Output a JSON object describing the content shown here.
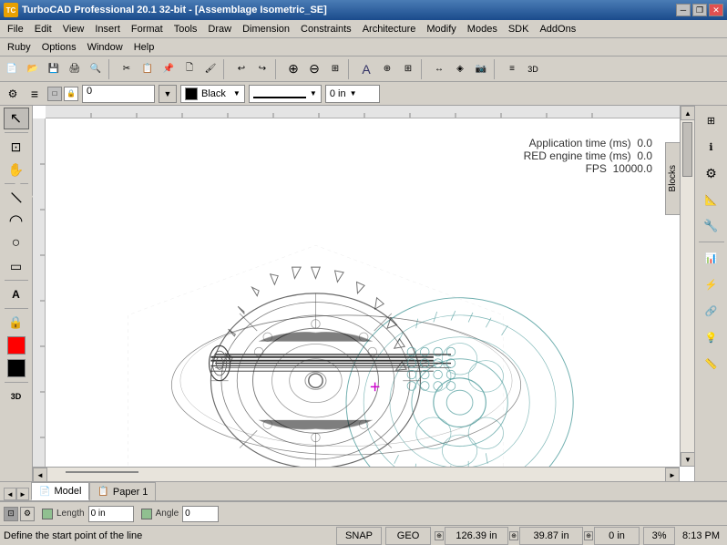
{
  "titlebar": {
    "icon_label": "TC",
    "title": "TurboCAD Professional 20.1 32-bit - [Assemblage Isometric_SE]",
    "minimize_label": "─",
    "maximize_label": "□",
    "close_label": "✕",
    "restore_label": "❐"
  },
  "menubar": {
    "items": [
      "File",
      "Edit",
      "View",
      "Insert",
      "Format",
      "Tools",
      "Draw",
      "Dimension",
      "Constraints",
      "Architecture",
      "Modify",
      "Modes",
      "SDK",
      "AddOns"
    ]
  },
  "menubar2": {
    "items": [
      "Ruby",
      "Options",
      "Window",
      "Help"
    ]
  },
  "toolbar": {
    "buttons": [
      {
        "name": "new",
        "label": "📄"
      },
      {
        "name": "open",
        "label": "📂"
      },
      {
        "name": "save",
        "label": "💾"
      },
      {
        "name": "print",
        "label": "🖨"
      },
      {
        "name": "preview",
        "label": "🔍"
      },
      {
        "name": "cut",
        "label": "✂"
      },
      {
        "name": "copy",
        "label": "📋"
      },
      {
        "name": "paste",
        "label": "📌"
      },
      {
        "name": "paster",
        "label": "🗋"
      },
      {
        "name": "propbrush",
        "label": "🖌"
      },
      {
        "name": "undo",
        "label": "↩"
      },
      {
        "name": "redo",
        "label": "↪"
      },
      {
        "name": "zoomin",
        "label": "🔍"
      },
      {
        "name": "zoomout",
        "label": "🔎"
      },
      {
        "name": "zoomall",
        "label": "⊞"
      },
      {
        "name": "text",
        "label": "A"
      },
      {
        "name": "snap",
        "label": "⊕"
      },
      {
        "name": "grid",
        "label": "⊞"
      },
      {
        "name": "ortho",
        "label": "T"
      },
      {
        "name": "layer",
        "label": "≡"
      },
      {
        "name": "dim",
        "label": "↔"
      },
      {
        "name": "render",
        "label": "◈"
      },
      {
        "name": "camera",
        "label": "📷"
      }
    ]
  },
  "ctrlbar": {
    "layer_value": "0",
    "color_value": "Black",
    "linetype_value": "──────",
    "linewidth_value": "0 in"
  },
  "left_toolbar": {
    "buttons": [
      {
        "name": "select",
        "label": "↖",
        "active": true
      },
      {
        "name": "zoom-window",
        "label": "⊡"
      },
      {
        "name": "zoom-pan",
        "label": "✋"
      },
      {
        "name": "line",
        "label": "╱"
      },
      {
        "name": "arc",
        "label": "◠"
      },
      {
        "name": "circle",
        "label": "○"
      },
      {
        "name": "rectangle",
        "label": "▭"
      },
      {
        "name": "text-tool",
        "label": "A"
      },
      {
        "name": "lock",
        "label": "🔒"
      },
      {
        "name": "color-box",
        "label": "■"
      },
      {
        "name": "3d",
        "label": "3D"
      }
    ]
  },
  "right_toolbar": {
    "buttons": [
      {
        "name": "block-manager",
        "label": "⊞"
      },
      {
        "name": "inspector",
        "label": "ℹ"
      },
      {
        "name": "prop1",
        "label": "⚙"
      },
      {
        "name": "prop2",
        "label": "📐"
      },
      {
        "name": "prop3",
        "label": "🔧"
      },
      {
        "name": "prop4",
        "label": "📊"
      },
      {
        "name": "prop5",
        "label": "⚡"
      },
      {
        "name": "prop6",
        "label": "🔗"
      },
      {
        "name": "prop7",
        "label": "💡"
      },
      {
        "name": "prop8",
        "label": "📏"
      }
    ],
    "blocks_label": "Blocks"
  },
  "canvas": {
    "background": "white",
    "perf_stats": {
      "app_time_label": "Application time (ms)",
      "app_time_value": "0.0",
      "red_time_label": "RED engine time (ms)",
      "red_time_value": "0.0",
      "fps_label": "FPS",
      "fps_value": "10000.0"
    }
  },
  "tabbar": {
    "tabs": [
      {
        "name": "model",
        "label": "Model",
        "active": true,
        "icon": "📄"
      },
      {
        "name": "paper1",
        "label": "Paper 1",
        "active": false,
        "icon": "📋"
      }
    ]
  },
  "coordbar": {
    "length_label": "Length",
    "length_value": "0 in",
    "angle_label": "Angle",
    "angle_value": "0"
  },
  "statusbar": {
    "status_text": "Define the start point of the line",
    "snap_label": "SNAP",
    "geo_label": "GEO",
    "x_value": "126.39 in",
    "y_value": "39.87 in",
    "z_value": "0 in",
    "zoom_value": "3%",
    "time_value": "8:13 PM"
  }
}
